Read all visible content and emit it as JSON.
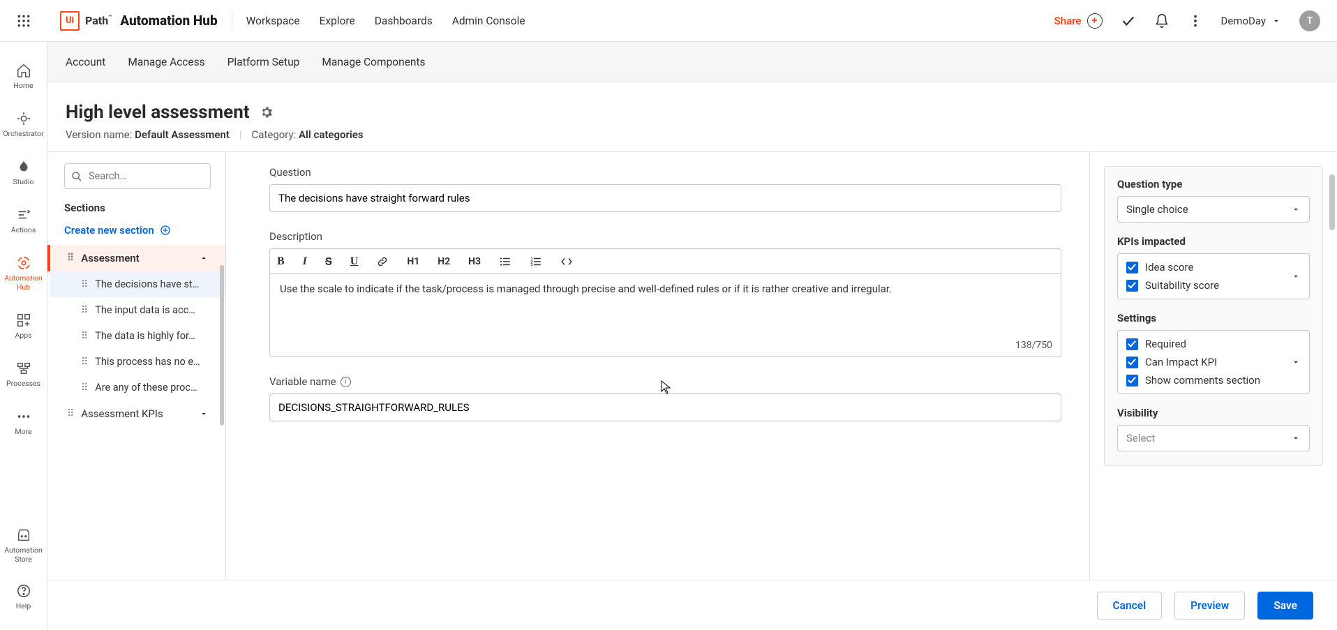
{
  "topbar": {
    "logo_path": "Path",
    "logo_hub": "Automation Hub",
    "nav": [
      "Workspace",
      "Explore",
      "Dashboards",
      "Admin Console"
    ],
    "share": "Share",
    "tenant": "DemoDay",
    "avatar": "T"
  },
  "leftrail": {
    "items": [
      "Home",
      "Orchestrator",
      "Studio",
      "Actions",
      "Automation Hub",
      "Apps",
      "Processes",
      "More"
    ],
    "bottom": [
      "Automation Store",
      "Help"
    ]
  },
  "subheader": {
    "items": [
      "Account",
      "Manage Access",
      "Platform Setup",
      "Manage Components"
    ]
  },
  "title": {
    "heading": "High level assessment",
    "version_label": "Version name:",
    "version_value": "Default Assessment",
    "category_label": "Category:",
    "category_value": "All categories"
  },
  "sections": {
    "search_placeholder": "Search…",
    "label": "Sections",
    "create": "Create new section",
    "group1": "Assessment",
    "questions": [
      "The decisions have st…",
      "The input data is acc…",
      "The data is highly for…",
      "This process has no e…",
      "Are any of these proc…"
    ],
    "group2": "Assessment KPIs"
  },
  "form": {
    "question_label": "Question",
    "question_value": "The decisions have straight forward rules",
    "desc_label": "Description",
    "desc_value": "Use the scale to indicate if the task/process is managed through precise and well-defined rules or if it is rather creative and irregular.",
    "desc_count": "138/750",
    "var_label": "Variable name",
    "var_value": "DECISIONS_STRAIGHTFORWARD_RULES",
    "toolbar": {
      "h1": "H1",
      "h2": "H2",
      "h3": "H3"
    }
  },
  "rightpanel": {
    "qtype_label": "Question type",
    "qtype_value": "Single choice",
    "kpi_label": "KPIs impacted",
    "kpi1": "Idea score",
    "kpi2": "Suitability score",
    "settings_label": "Settings",
    "set1": "Required",
    "set2": "Can Impact KPI",
    "set3": "Show comments section",
    "vis_label": "Visibility",
    "vis_value": "Select"
  },
  "footer": {
    "cancel": "Cancel",
    "preview": "Preview",
    "save": "Save"
  }
}
